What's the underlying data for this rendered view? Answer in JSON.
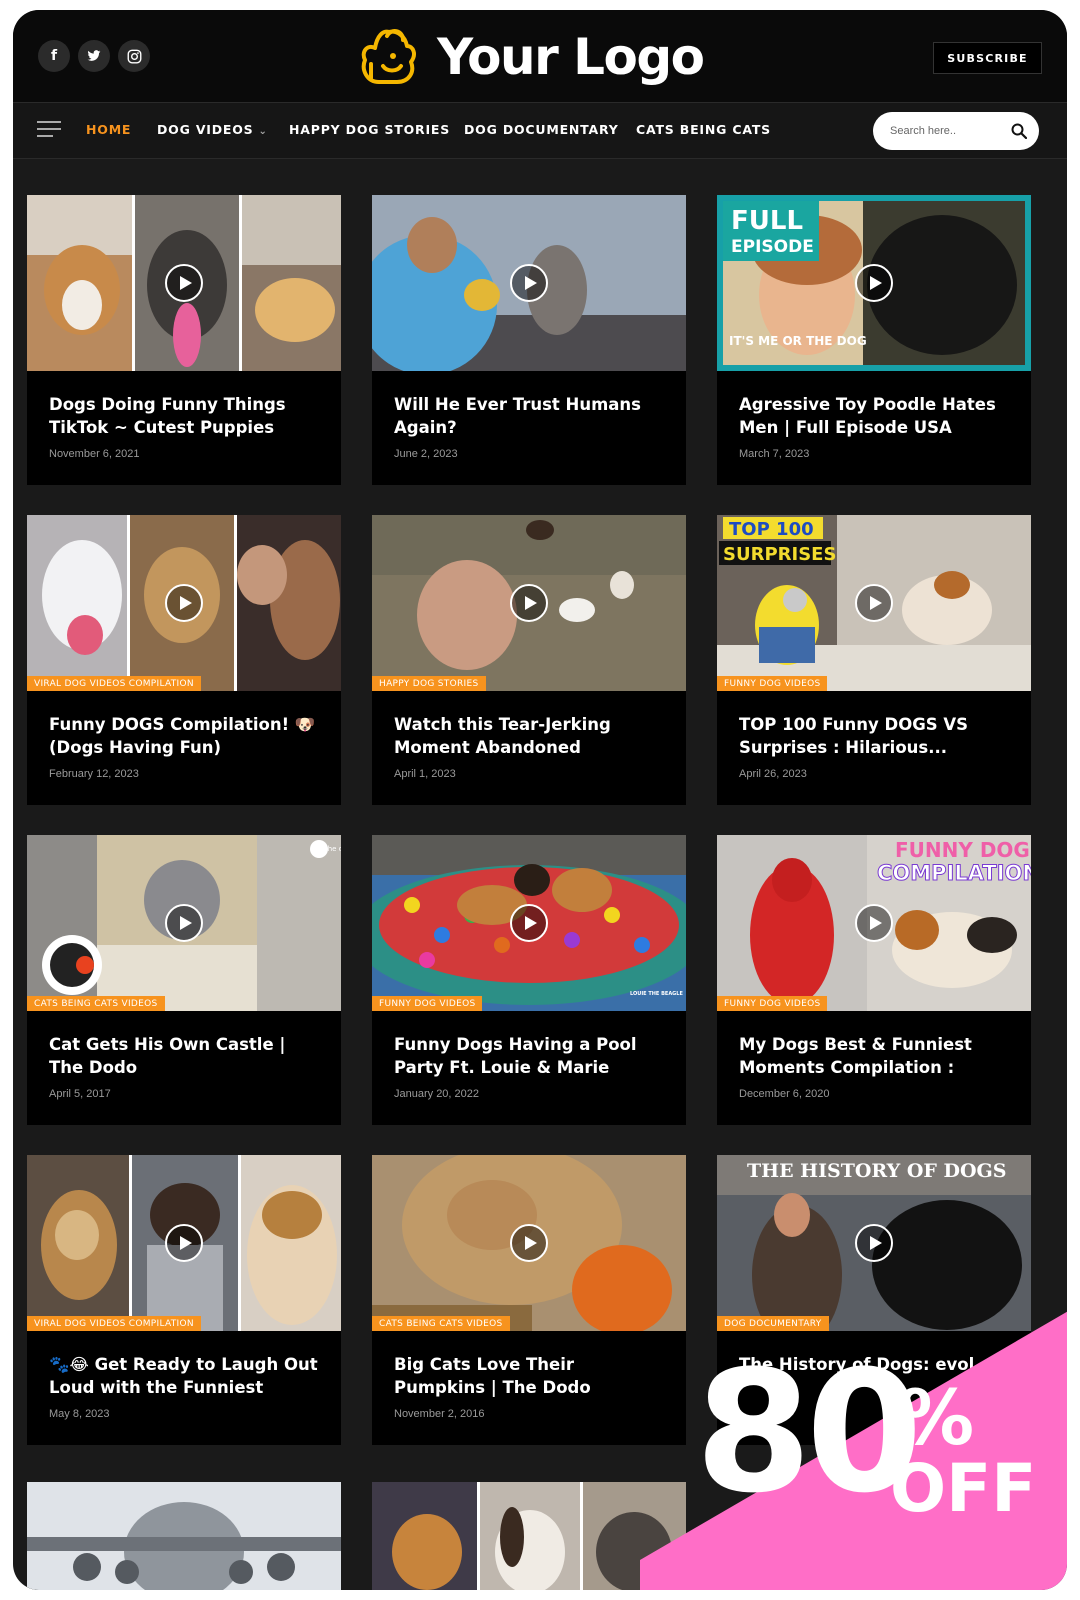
{
  "header": {
    "logo_text": "Your Logo",
    "subscribe_label": "SUBSCRIBE",
    "socials": [
      {
        "icon": "facebook-icon",
        "glyph": "f"
      },
      {
        "icon": "twitter-icon",
        "glyph": "t"
      },
      {
        "icon": "instagram-icon",
        "glyph": "◎"
      }
    ]
  },
  "nav": {
    "items": [
      {
        "label": "HOME",
        "active": true
      },
      {
        "label": "DOG VIDEOS",
        "dropdown": true
      },
      {
        "label": "HAPPY DOG STORIES"
      },
      {
        "label": "DOG DOCUMENTARY"
      },
      {
        "label": "CATS BEING CATS"
      }
    ],
    "search_placeholder": "Search here.."
  },
  "colors": {
    "accent": "#f7931e",
    "background": "#1a1a1a",
    "card": "#000000",
    "promo": "#ff6ec7"
  },
  "posts": [
    {
      "title": "Dogs Doing Funny Things TikTok ~ Cutest Puppies TIK...",
      "date": "November 6, 2021",
      "category": ""
    },
    {
      "title": "Will He Ever Trust Humans Again?",
      "date": "June 2, 2023",
      "category": ""
    },
    {
      "title": "Agressive Toy Poodle Hates Men | Full Episode USA",
      "date": "March 7, 2023",
      "category": "",
      "overlay_1": "FULL",
      "overlay_2": "EPISODE",
      "overlay_3": "IT'S ME OR THE DOG"
    },
    {
      "title": "Funny DOGS Compilation! 🐶 (Dogs Having Fun)",
      "date": "February 12, 2023",
      "category": "VIRAL DOG VIDEOS COMPILATION"
    },
    {
      "title": "Watch this Tear-Jerking Moment Abandoned Puppie...",
      "date": "April 1, 2023",
      "category": "HAPPY DOG STORIES"
    },
    {
      "title": "TOP 100 Funny DOGS VS Surprises : Hilarious...",
      "date": "April 26, 2023",
      "category": "FUNNY DOG VIDEOS",
      "overlay_1": "TOP 100",
      "overlay_2": "SURPRISES"
    },
    {
      "title": "Cat Gets His Own Castle | The Dodo",
      "date": "April 5, 2017",
      "category": "CATS BEING CATS VIDEOS",
      "overlay_1": "the dodo"
    },
    {
      "title": "Funny Dogs Having a Pool Party Ft. Louie & Marie",
      "date": "January 20, 2022",
      "category": "FUNNY DOG VIDEOS",
      "overlay_1": "LOUIE THE BEAGLE"
    },
    {
      "title": "My Dogs Best & Funniest Moments Compilation : Loui...",
      "date": "December 6, 2020",
      "category": "FUNNY DOG VIDEOS",
      "overlay_1": "FUNNY DOGS",
      "overlay_2": "COMPILATION"
    },
    {
      "title": "🐾😂 Get Ready to Laugh Out Loud with the Funniest Dog...",
      "date": "May 8, 2023",
      "category": "VIRAL DOG VIDEOS COMPILATION"
    },
    {
      "title": "Big Cats Love Their Pumpkins | The Dodo",
      "date": "November 2, 2016",
      "category": "CATS BEING CATS VIDEOS"
    },
    {
      "title": "The History of Dogs: evol...",
      "date": "",
      "category": "DOG DOCUMENTARY",
      "overlay_1": "THE HISTORY OF DOGS"
    },
    {
      "title": "",
      "date": "",
      "category": ""
    },
    {
      "title": "",
      "date": "",
      "category": ""
    }
  ],
  "promo": {
    "number": "80",
    "percent": "%",
    "off": "OFF"
  }
}
